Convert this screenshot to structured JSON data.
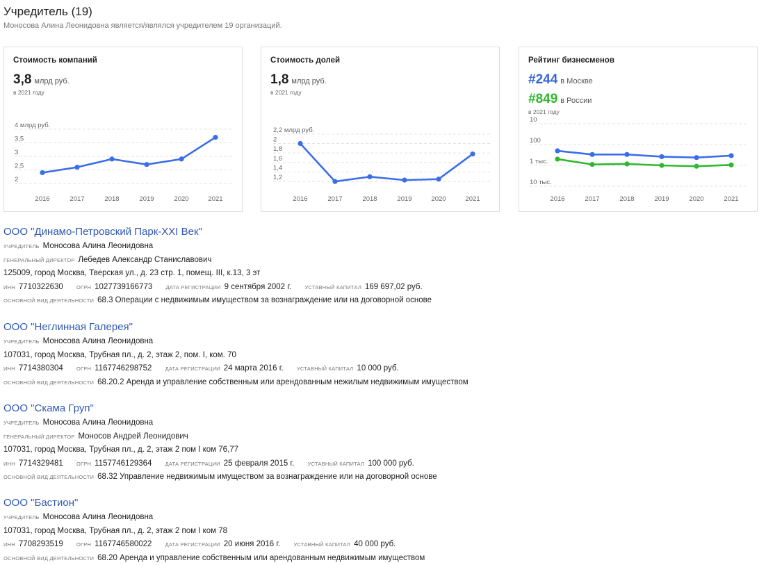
{
  "header": {
    "title": "Учредитель (19)",
    "subtitle": "Моносова Алина Леонидовна является/являлся учредителем 19 организаций."
  },
  "cards": {
    "companies_value": {
      "title": "Стоимость компаний",
      "value": "3,8",
      "unit": "млрд руб.",
      "note": "в 2021 году"
    },
    "shares_value": {
      "title": "Стоимость долей",
      "value": "1,8",
      "unit": "млрд руб.",
      "note": "в 2021 году"
    },
    "rating": {
      "title": "Рейтинг бизнесменов",
      "moscow_hash": "#244",
      "moscow_label": "в Москве",
      "russia_hash": "#849",
      "russia_label": "в России",
      "note": "в 2021 году"
    }
  },
  "chart_data": [
    {
      "type": "line",
      "x": [
        "2016",
        "2017",
        "2018",
        "2019",
        "2020",
        "2021"
      ],
      "series": [
        {
          "values": [
            2.4,
            2.6,
            2.9,
            2.7,
            2.9,
            3.7
          ],
          "color": "#3a6ee8"
        }
      ],
      "y_ticks": [
        "4 млрд руб.",
        "3,5",
        "3",
        "2,5",
        "2"
      ],
      "y_tick_values": [
        4,
        3.5,
        3,
        2.5,
        2
      ],
      "ylim": [
        1.9,
        4.2
      ],
      "grid": true
    },
    {
      "type": "line",
      "x": [
        "2016",
        "2017",
        "2018",
        "2019",
        "2020",
        "2021"
      ],
      "series": [
        {
          "values": [
            2.0,
            1.2,
            1.3,
            1.23,
            1.25,
            1.78
          ],
          "color": "#3a6ee8"
        }
      ],
      "y_ticks": [
        "2,2 млрд руб.",
        "2",
        "1,8",
        "1,6",
        "1,4",
        "1,2"
      ],
      "y_tick_values": [
        2.2,
        2.0,
        1.8,
        1.6,
        1.4,
        1.2
      ],
      "ylim": [
        1.1,
        2.3
      ],
      "grid": true
    },
    {
      "type": "line",
      "scale": "log-reversed",
      "x": [
        "2016",
        "2017",
        "2018",
        "2019",
        "2020",
        "2021"
      ],
      "series": [
        {
          "name": "в Москве",
          "values": [
            200,
            300,
            300,
            380,
            420,
            340
          ],
          "color": "#3a6ee8"
        },
        {
          "name": "в России",
          "values": [
            500,
            900,
            850,
            1000,
            1100,
            950
          ],
          "color": "#2eb82e"
        }
      ],
      "y_ticks": [
        "10",
        "100",
        "1 тыс.",
        "10 тыс."
      ],
      "y_tick_values": [
        10,
        100,
        1000,
        10000
      ],
      "ylim": [
        10,
        10000
      ],
      "grid": true
    }
  ],
  "labels": {
    "founder": "Учредитель",
    "director": "Генеральный директор",
    "inn": "ИНН",
    "ogrn": "ОГРН",
    "reg_date": "Дата регистрации",
    "capital": "Уставный капитал",
    "activity": "Основной вид деятельности"
  },
  "companies": [
    {
      "name": "ООО \"Динамо-Петровский Парк-XXI Век\"",
      "founder": "Моносова Алина Леонидовна",
      "director": "Лебедев Александр Станиславович",
      "address": "125009, город Москва, Тверская ул., д. 23 стр. 1, помещ. III, к.13, 3 эт",
      "inn": "7710322630",
      "ogrn": "1027739166773",
      "reg_date": "9 сентября 2002 г.",
      "capital": "169 697,02 руб.",
      "activity": "68.3 Операции с недвижимым имуществом за вознаграждение или на договорной основе"
    },
    {
      "name": "ООО \"Неглинная Галерея\"",
      "founder": "Моносова Алина Леонидовна",
      "address": "107031, город Москва, Трубная пл., д. 2, этаж 2, пом. I, ком. 70",
      "inn": "7714380304",
      "ogrn": "1167746298752",
      "reg_date": "24 марта 2016 г.",
      "capital": "10 000 руб.",
      "activity": "68.20.2 Аренда и управление собственным или арендованным нежилым недвижимым имуществом"
    },
    {
      "name": "ООО \"Скама Груп\"",
      "founder": "Моносова Алина Леонидовна",
      "director": "Моносов Андрей Леонидович",
      "address": "107031, город Москва, Трубная пл., д. 2, этаж 2 пом I ком 76,77",
      "inn": "7714329481",
      "ogrn": "1157746129364",
      "reg_date": "25 февраля 2015 г.",
      "capital": "100 000 руб.",
      "activity": "68.32 Управление недвижимым имуществом за вознаграждение или на договорной основе"
    },
    {
      "name": "ООО \"Бастион\"",
      "founder": "Моносова Алина Леонидовна",
      "address": "107031, город Москва, Трубная пл., д. 2, этаж 2 пом I ком 78",
      "inn": "7708293519",
      "ogrn": "1167746580022",
      "reg_date": "20 июня 2016 г.",
      "capital": "40 000 руб.",
      "activity": "68.20 Аренда и управление собственным или арендованным недвижимым имуществом"
    }
  ]
}
